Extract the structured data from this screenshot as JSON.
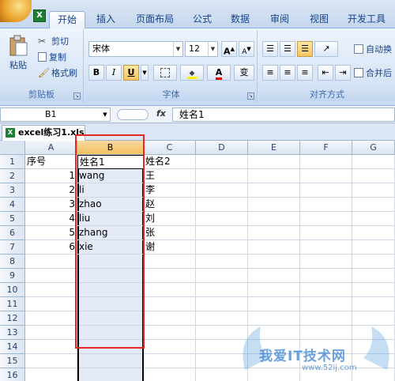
{
  "tabs": [
    {
      "label": "开始",
      "active": true
    },
    {
      "label": "插入"
    },
    {
      "label": "页面布局"
    },
    {
      "label": "公式"
    },
    {
      "label": "数据"
    },
    {
      "label": "审阅"
    },
    {
      "label": "视图"
    },
    {
      "label": "开发工具"
    }
  ],
  "clipboard": {
    "paste": "粘贴",
    "cut": "剪切",
    "copy": "复制",
    "format_painter": "格式刷",
    "label": "剪贴板"
  },
  "font": {
    "name": "宋体",
    "size": "12",
    "bold": "B",
    "italic": "I",
    "underline": "U",
    "label": "字体",
    "wen": "变"
  },
  "alignment": {
    "wrap": "自动换",
    "merge": "合并后",
    "label": "对齐方式"
  },
  "formula_bar": {
    "name_box": "B1",
    "fx": "fx",
    "content": "姓名1"
  },
  "workbook": {
    "tab": "excel练习1.xls"
  },
  "columns": [
    "A",
    "B",
    "C",
    "D",
    "E",
    "F",
    "G"
  ],
  "rows": [
    "1",
    "2",
    "3",
    "4",
    "5",
    "6",
    "7",
    "8",
    "9",
    "10",
    "11",
    "12",
    "13",
    "14",
    "15",
    "16"
  ],
  "sheet": {
    "a1": "序号",
    "b1": "姓名1",
    "c1": "姓名2",
    "data": [
      {
        "a": "1",
        "b": "wang",
        "c": "王"
      },
      {
        "a": "2",
        "b": "li",
        "c": "李"
      },
      {
        "a": "3",
        "b": "zhao",
        "c": "赵"
      },
      {
        "a": "4",
        "b": "liu",
        "c": "刘"
      },
      {
        "a": "5",
        "b": "zhang",
        "c": "张"
      },
      {
        "a": "6",
        "b": "xie",
        "c": "谢"
      }
    ]
  },
  "watermark": {
    "title": "我爱IT技术网",
    "url": "www.52ij.com"
  },
  "colors": {
    "accent": "#15428b",
    "selection": "#f1c15f",
    "highlight_box": "#e82828"
  }
}
